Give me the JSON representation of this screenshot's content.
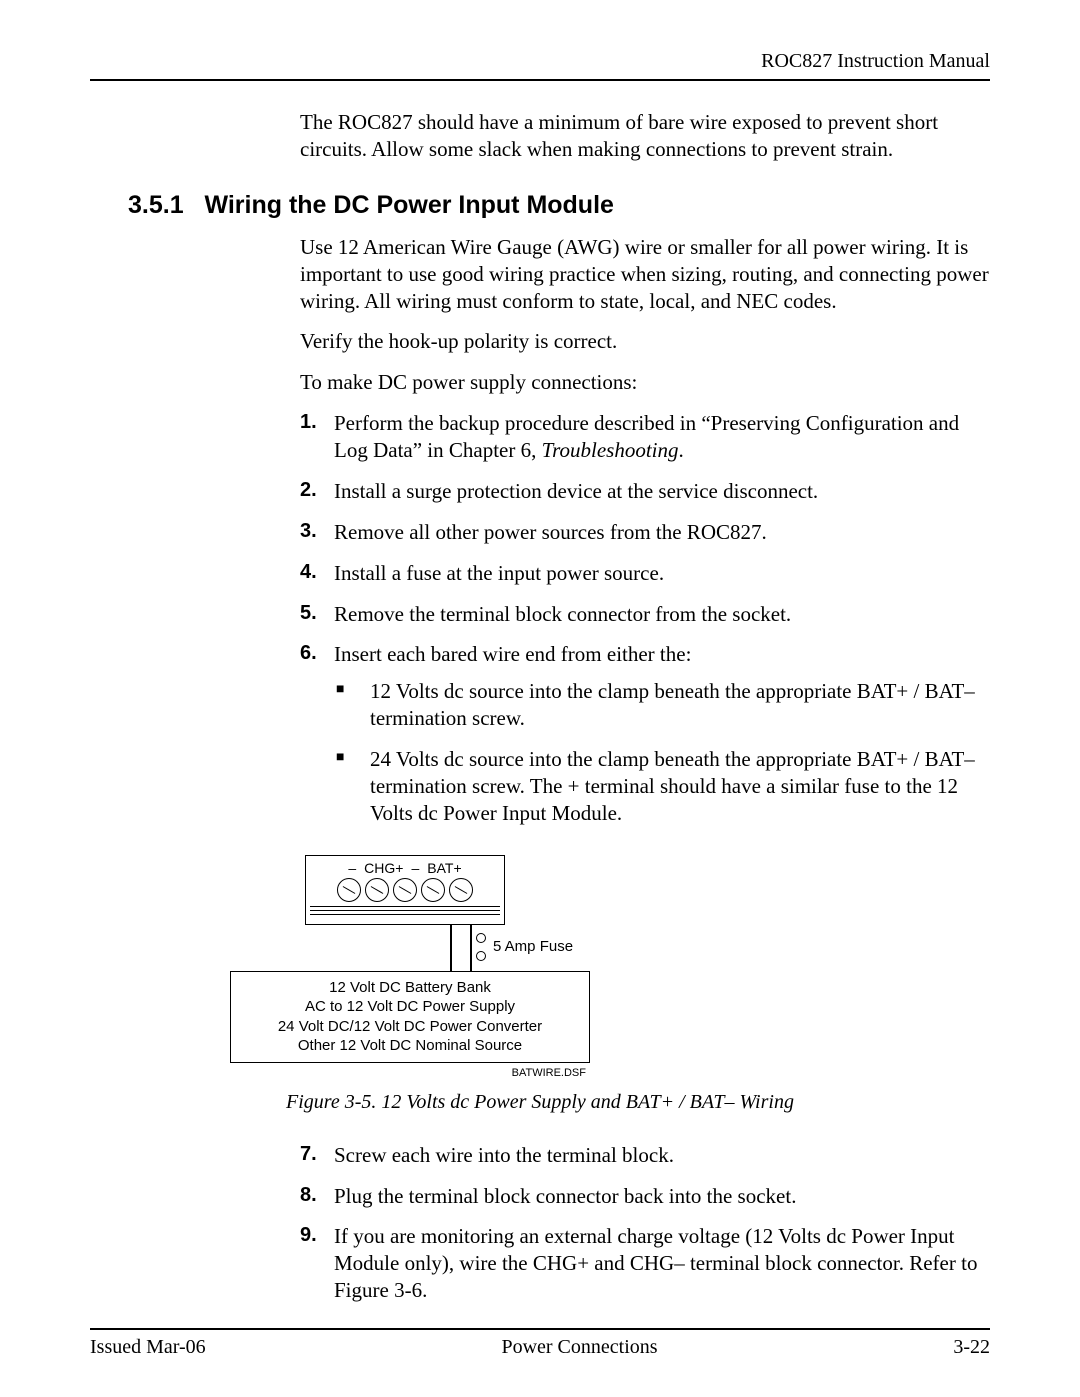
{
  "header": {
    "doc_title": "ROC827 Instruction Manual"
  },
  "intro": "The ROC827 should have a minimum of bare wire exposed to prevent short circuits. Allow some slack when making connections to prevent strain.",
  "section": {
    "number": "3.5.1",
    "title": "Wiring the DC Power Input Module",
    "p1": "Use 12 American Wire Gauge (AWG) wire or smaller for all power wiring. It is important to use good wiring practice when sizing, routing, and connecting power wiring. All wiring must conform to state, local, and NEC codes.",
    "p2": "Verify the hook-up polarity is correct.",
    "p3": "To make DC power supply connections:"
  },
  "steps": [
    {
      "n": "1.",
      "t_pre": "Perform the backup procedure described in “Preserving Configuration and Log Data” in Chapter 6, ",
      "t_em": "Troubleshooting",
      "t_post": "."
    },
    {
      "n": "2.",
      "t": "Install a surge protection device at the service disconnect."
    },
    {
      "n": "3.",
      "t": "Remove all other power sources from the ROC827."
    },
    {
      "n": "4.",
      "t": "Install a fuse at the input power source."
    },
    {
      "n": "5.",
      "t": "Remove the terminal block connector from the socket."
    },
    {
      "n": "6.",
      "t": "Insert each bared wire end from either the:",
      "sub": [
        "12 Volts dc source into the clamp beneath the appropriate BAT+ / BAT– termination screw.",
        "24 Volts dc source into the clamp beneath the appropriate BAT+ / BAT– termination screw. The + terminal should have a similar fuse to the 12 Volts dc Power Input Module."
      ]
    }
  ],
  "figure": {
    "term_labels": [
      "–",
      "CHG+",
      "–",
      "BAT+"
    ],
    "fuse_label": "5 Amp Fuse",
    "src_lines": [
      "12 Volt DC Battery Bank",
      "AC to 12 Volt DC Power Supply",
      "24 Volt DC/12 Volt DC Power Converter",
      "Other 12 Volt DC Nominal Source"
    ],
    "dsf": "BATWIRE.DSF",
    "caption": "Figure 3-5. 12 Volts dc Power Supply and BAT+ / BAT– Wiring"
  },
  "steps2": [
    {
      "n": "7.",
      "t": "Screw each wire into the terminal block."
    },
    {
      "n": "8.",
      "t": "Plug the terminal block connector back into the socket."
    },
    {
      "n": "9.",
      "t": "If you are monitoring an external charge voltage (12 Volts dc Power Input Module only), wire the CHG+ and CHG– terminal block connector. Refer to Figure 3-6."
    }
  ],
  "footer": {
    "left": "Issued Mar-06",
    "center": "Power Connections",
    "right": "3-22"
  }
}
